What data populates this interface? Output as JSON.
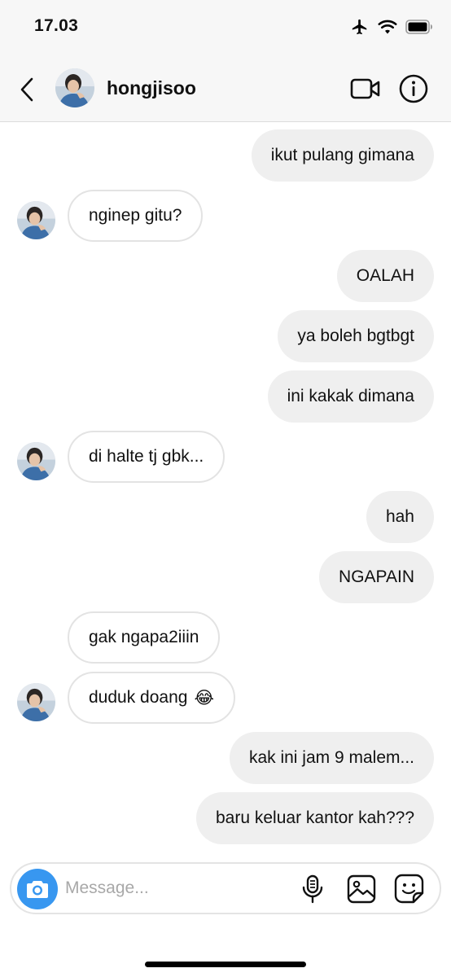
{
  "status_bar": {
    "time": "17.03"
  },
  "header": {
    "username": "hongjisoo"
  },
  "messages": [
    {
      "text": "ikut pulang gimana",
      "direction": "outgoing"
    },
    {
      "text": "nginep gitu?",
      "direction": "incoming",
      "avatar": true
    },
    {
      "text": "OALAH",
      "direction": "outgoing"
    },
    {
      "text": "ya boleh bgtbgt",
      "direction": "outgoing"
    },
    {
      "text": "ini kakak dimana",
      "direction": "outgoing"
    },
    {
      "text": "di halte tj gbk...",
      "direction": "incoming",
      "avatar": true
    },
    {
      "text": "hah",
      "direction": "outgoing"
    },
    {
      "text": "NGAPAIN",
      "direction": "outgoing"
    },
    {
      "text": "gak ngapa2iiin",
      "direction": "incoming",
      "avatar": false
    },
    {
      "text": "duduk doang",
      "emoji": "😂",
      "direction": "incoming",
      "avatar": true
    },
    {
      "text": "kak ini jam 9 malem...",
      "direction": "outgoing"
    },
    {
      "text": "baru keluar kantor kah???",
      "direction": "outgoing"
    }
  ],
  "composer": {
    "placeholder": "Message..."
  },
  "colors": {
    "outgoing_bubble": "#efefef",
    "incoming_border": "#e3e3e3",
    "camera_button": "#3897f0"
  }
}
